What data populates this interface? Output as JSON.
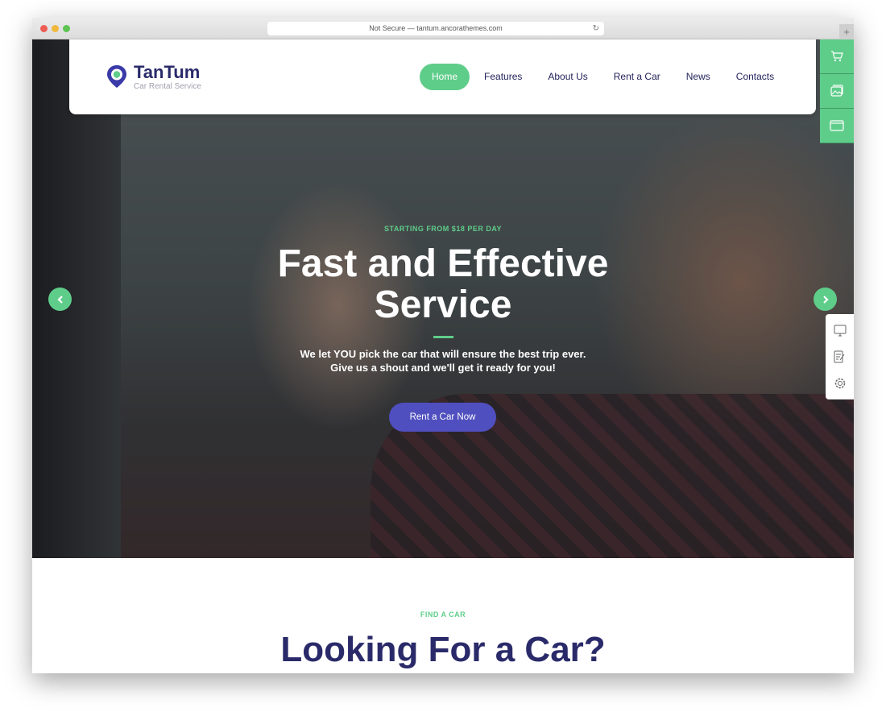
{
  "browser": {
    "url": "Not Secure — tantum.ancorathemes.com"
  },
  "header": {
    "brand": "TanTum",
    "tagline": "Car Rental Service",
    "nav": [
      {
        "label": "Home",
        "active": true
      },
      {
        "label": "Features"
      },
      {
        "label": "About Us"
      },
      {
        "label": "Rent a Car"
      },
      {
        "label": "News"
      },
      {
        "label": "Contacts"
      }
    ]
  },
  "side_tools": [
    "cart-icon",
    "gallery-icon",
    "window-icon"
  ],
  "side_panel": [
    "monitor-icon",
    "document-edit-icon",
    "gear-icon"
  ],
  "hero": {
    "eyebrow": "STARTING FROM $18 PER DAY",
    "title_line1": "Fast and Effective",
    "title_line2": "Service",
    "subtitle_line1": "We let YOU pick the car that will ensure the best trip ever.",
    "subtitle_line2": "Give us a shout and we'll get it ready for you!",
    "cta": "Rent a Car Now"
  },
  "section": {
    "eyebrow": "FIND A CAR",
    "title": "Looking For a Car?"
  },
  "colors": {
    "accent_green": "#5fcd8a",
    "brand_purple": "#4f4fbf",
    "heading_navy": "#2a2a6a"
  }
}
